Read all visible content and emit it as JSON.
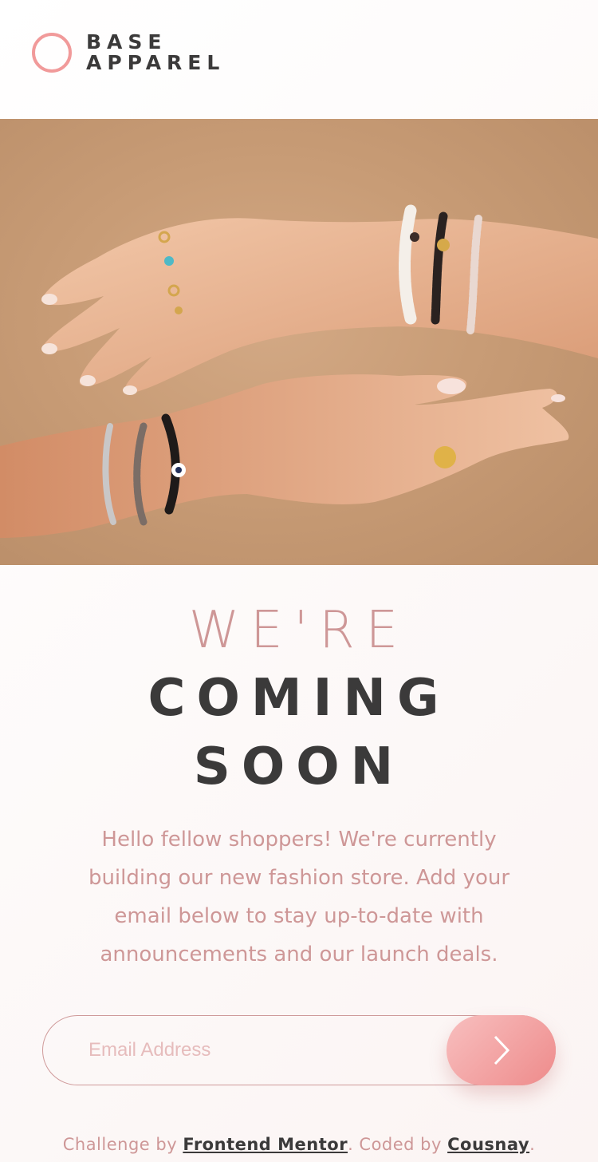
{
  "brand": {
    "line1": "BASE",
    "line2": "APPAREL",
    "accent_color": "#f19a9a",
    "text_color": "#3b3a3a"
  },
  "hero": {
    "image_icon": "hands-with-bracelets-image"
  },
  "heading": {
    "light": "WE'RE",
    "bold_line1": "COMING",
    "bold_line2": "SOON"
  },
  "description": "Hello fellow shoppers! We're currently building our new fashion store. Add your email below to stay up-to-date with announcements and our launch deals.",
  "form": {
    "email_placeholder": "Email Address",
    "email_value": "",
    "submit_icon": "chevron-right-icon"
  },
  "footer": {
    "prefix": "Challenge by ",
    "link1": "Frontend Mentor",
    "middle": ". Coded by ",
    "link2": "Cousnay",
    "suffix": "."
  },
  "colors": {
    "soft_pink": "#ce9797",
    "button_gradient_start": "#f8bfbf",
    "button_gradient_end": "#ee8b8b",
    "dark_grayish_red": "#3b3a3a"
  }
}
